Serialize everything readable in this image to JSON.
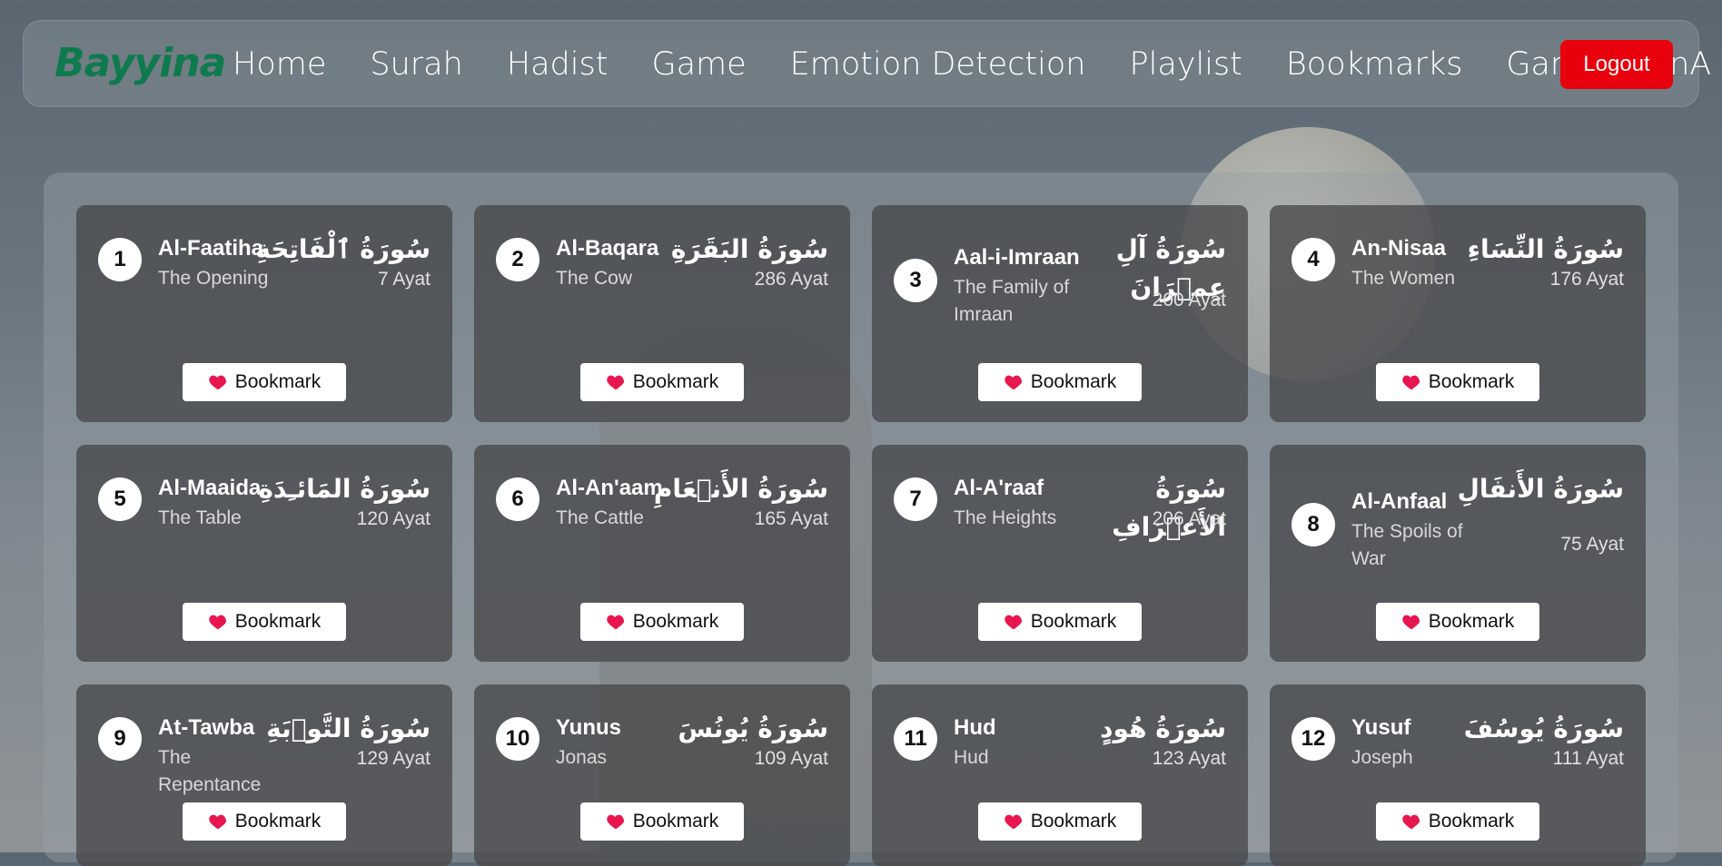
{
  "app": {
    "logo": "Bayyina"
  },
  "nav": {
    "items": [
      "Home",
      "Surah",
      "Hadist",
      "Game",
      "Emotion Detection",
      "Playlist",
      "Bookmarks",
      "Game",
      "QnA"
    ],
    "logout_label": "Logout"
  },
  "bookmark_label": "Bookmark",
  "surahs": [
    {
      "number": "1",
      "name": "Al-Faatiha",
      "meaning": "The Opening",
      "arabic": "سُورَةُ ٱلْفَاتِحَةِ",
      "ayat": "7 Ayat"
    },
    {
      "number": "2",
      "name": "Al-Baqara",
      "meaning": "The Cow",
      "arabic": "سُورَةُ البَقَرَةِ",
      "ayat": "286 Ayat"
    },
    {
      "number": "3",
      "name": "Aal-i-Imraan",
      "meaning": "The Family of Imraan",
      "arabic": "سُورَةُ آلِ عِمۡرَانَ",
      "ayat": "200 Ayat"
    },
    {
      "number": "4",
      "name": "An-Nisaa",
      "meaning": "The Women",
      "arabic": "سُورَةُ النِّسَاءِ",
      "ayat": "176 Ayat"
    },
    {
      "number": "5",
      "name": "Al-Maaida",
      "meaning": "The Table",
      "arabic": "سُورَةُ المَائـِدَةِ",
      "ayat": "120 Ayat"
    },
    {
      "number": "6",
      "name": "Al-An'aam",
      "meaning": "The Cattle",
      "arabic": "سُورَةُ الأَنۡعَامِ",
      "ayat": "165 Ayat"
    },
    {
      "number": "7",
      "name": "Al-A'raaf",
      "meaning": "The Heights",
      "arabic": "سُورَةُ الأَعۡرَافِ",
      "ayat": "206 Ayat"
    },
    {
      "number": "8",
      "name": "Al-Anfaal",
      "meaning": "The Spoils of War",
      "arabic": "سُورَةُ الأَنفَالِ",
      "ayat": "75 Ayat"
    },
    {
      "number": "9",
      "name": "At-Tawba",
      "meaning": "The Repentance",
      "arabic": "سُورَةُ التَّوۡبَةِ",
      "ayat": "129 Ayat"
    },
    {
      "number": "10",
      "name": "Yunus",
      "meaning": "Jonas",
      "arabic": "سُورَةُ يُونُسَ",
      "ayat": "109 Ayat"
    },
    {
      "number": "11",
      "name": "Hud",
      "meaning": "Hud",
      "arabic": "سُورَةُ هُودٍ",
      "ayat": "123 Ayat"
    },
    {
      "number": "12",
      "name": "Yusuf",
      "meaning": "Joseph",
      "arabic": "سُورَةُ يُوسُفَ",
      "ayat": "111 Ayat"
    }
  ],
  "colors": {
    "logo": "#0f7a4e",
    "logout": "#e8000c",
    "heart": "#e8164f"
  },
  "icons": {
    "bookmark": "heart-icon"
  }
}
